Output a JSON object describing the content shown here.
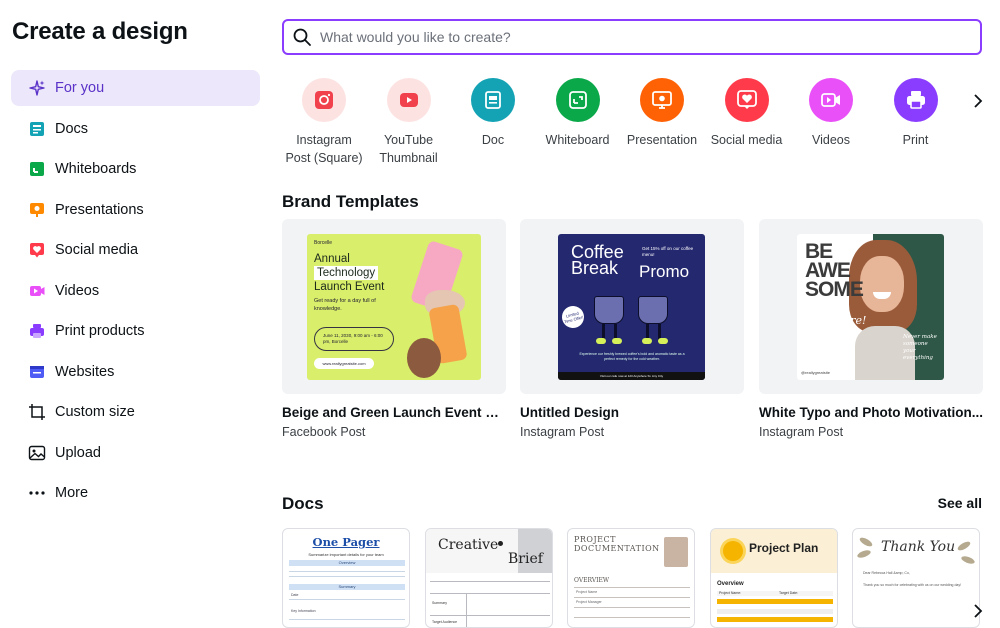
{
  "page_title": "Create a design",
  "sidebar": {
    "items": [
      {
        "label": "For you",
        "icon": "sparkle-icon",
        "active": true
      },
      {
        "label": "Docs",
        "icon": "docs-icon"
      },
      {
        "label": "Whiteboards",
        "icon": "whiteboard-icon"
      },
      {
        "label": "Presentations",
        "icon": "presentation-icon"
      },
      {
        "label": "Social media",
        "icon": "heart-icon"
      },
      {
        "label": "Videos",
        "icon": "video-icon"
      },
      {
        "label": "Print products",
        "icon": "printer-icon"
      },
      {
        "label": "Websites",
        "icon": "website-icon"
      },
      {
        "label": "Custom size",
        "icon": "crop-icon"
      },
      {
        "label": "Upload",
        "icon": "upload-image-icon"
      },
      {
        "label": "More",
        "icon": "more-dots-icon"
      }
    ]
  },
  "search": {
    "placeholder": "What would you like to create?",
    "value": ""
  },
  "categories": [
    {
      "label": "Instagram Post (Square)",
      "icon": "instagram-icon",
      "color": "#fde2e2",
      "icon_color": "#f0414d"
    },
    {
      "label": "YouTube Thumbnail",
      "icon": "youtube-icon",
      "color": "#fde2e2",
      "icon_color": "#f0414d"
    },
    {
      "label": "Doc",
      "icon": "doc-icon",
      "color": "#13a3b5"
    },
    {
      "label": "Whiteboard",
      "icon": "whiteboard-icon",
      "color": "#0ba84a"
    },
    {
      "label": "Presentation",
      "icon": "presentation-icon",
      "color": "#ff6105"
    },
    {
      "label": "Social media",
      "icon": "heart-icon",
      "color": "#ff3b4b"
    },
    {
      "label": "Videos",
      "icon": "video-icon",
      "color": "#e950f7"
    },
    {
      "label": "Print",
      "icon": "printer-icon",
      "color": "#8b3dff"
    }
  ],
  "brand_templates": {
    "title": "Brand Templates",
    "items": [
      {
        "name": "Beige and Green Launch Event Mo...",
        "type": "Facebook Post",
        "art": {
          "brand": "Borcelle",
          "heading": [
            "Annual",
            "Technology",
            "Launch Event"
          ],
          "subtitle": "Get ready for a day full of knowledge.",
          "date": "June 11, 2030, 9:00 am - 6:00 pm, Borcelle",
          "website": "www.reallygreatsite.com"
        }
      },
      {
        "name": "Untitled Design",
        "type": "Instagram Post",
        "art": {
          "line1": "Coffee",
          "line2": "Break",
          "line3": "Promo",
          "offer": "Get 15% off on our coffee menu!",
          "badge": "Limited Time Offer!",
          "desc": "Experience our freshly brewed coffee's bold and aromatic taste as a perfect remedy for the cold weather.",
          "footer": "Visit our cafe now at 123 Anywhere St. Any City"
        }
      },
      {
        "name": "White Typo and Photo Motivation...",
        "type": "Instagram Post",
        "art": {
          "big": [
            "BE",
            "AWE",
            "SOME"
          ],
          "script": "and more!",
          "quote": "Never make someone your everything",
          "handle": "@reallygreatsite"
        }
      }
    ]
  },
  "docs": {
    "title": "Docs",
    "see_all": "See all",
    "items": [
      {
        "title": "One Pager",
        "subtitle": "Summarize important details for your team",
        "bands": [
          "Overview",
          "Summary"
        ],
        "labels": [
          "Date",
          "Key Information"
        ]
      },
      {
        "title1": "Creative",
        "title2": "Brief",
        "labels": [
          "Summary",
          "Target Audience"
        ]
      },
      {
        "title": "PROJECT DOCUMENTATION",
        "section": "OVERVIEW",
        "labels": [
          "Project Name",
          "Project Manager"
        ]
      },
      {
        "title": "Project Plan",
        "section": "Overview",
        "labels": [
          "Project Name:",
          "Target Date:"
        ]
      },
      {
        "title": "Thank You",
        "labels": [
          "Dear Rebecca Hall &amp; Co,",
          "Thank you so much for celebrating with us on our wedding day!"
        ]
      }
    ]
  },
  "colors": {
    "accent": "#8b3dff",
    "active_bg": "#ece7fb",
    "active_text": "#5a32c8"
  }
}
